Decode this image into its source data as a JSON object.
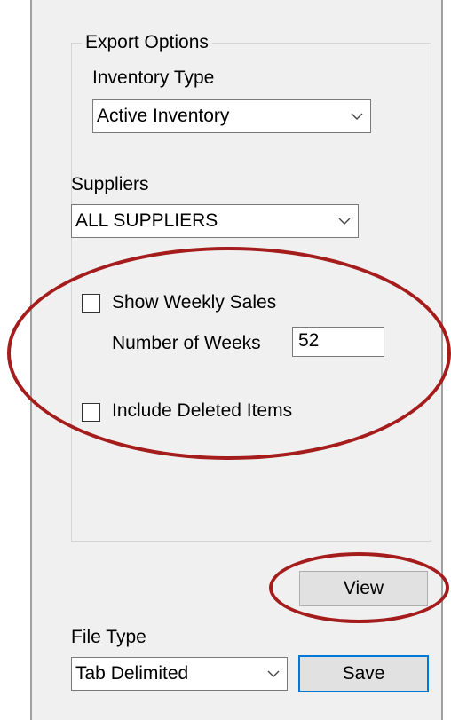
{
  "export_options": {
    "group_title": "Export Options",
    "inventory_type": {
      "label": "Inventory Type",
      "value": "Active Inventory"
    },
    "suppliers": {
      "label": "Suppliers",
      "value": "ALL SUPPLIERS"
    },
    "show_weekly_sales": {
      "label": "Show Weekly Sales",
      "checked": false
    },
    "number_of_weeks": {
      "label": "Number of Weeks",
      "value": "52"
    },
    "include_deleted": {
      "label": "Include Deleted Items",
      "checked": false
    }
  },
  "view_button": {
    "label": "View"
  },
  "file_type": {
    "label": "File Type",
    "value": "Tab Delimited"
  },
  "save_button": {
    "label": "Save"
  },
  "colors": {
    "highlight": "#a51c1c",
    "accent": "#0078d7"
  }
}
